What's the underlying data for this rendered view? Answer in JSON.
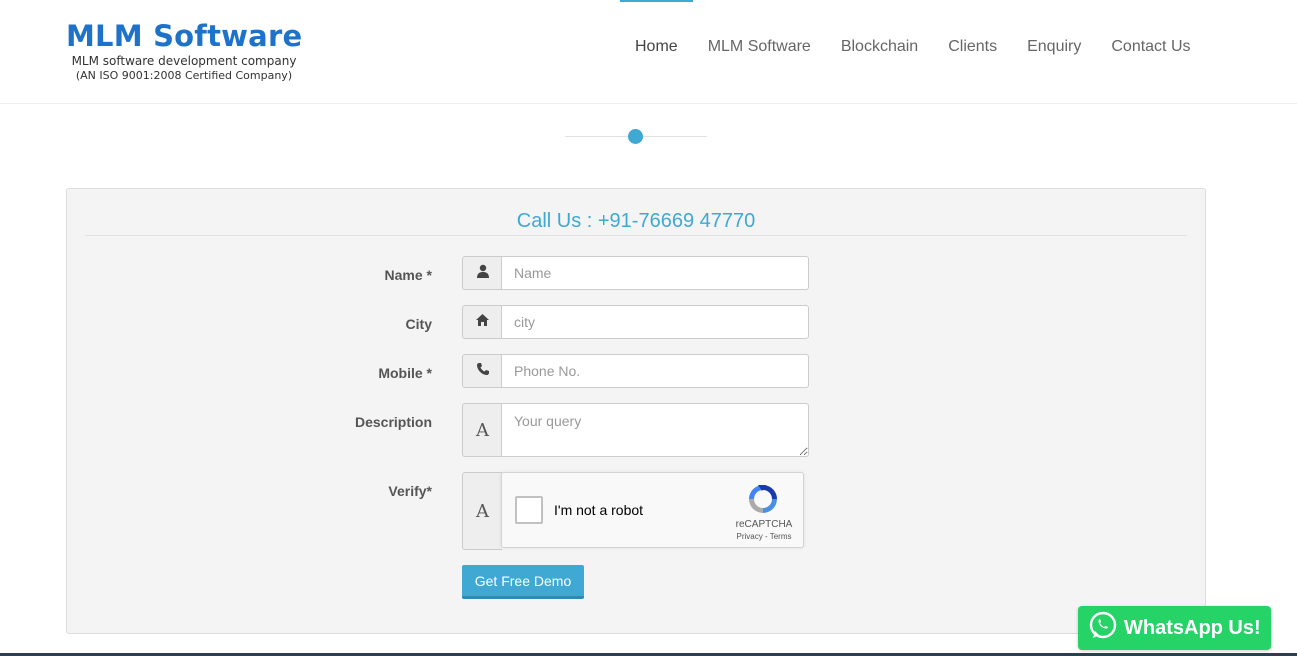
{
  "header": {
    "logo_title": "MLM Software",
    "logo_subtitle": "MLM software development company",
    "logo_certification": "(AN ISO 9001:2008 Certified Company)",
    "nav": [
      {
        "label": "Home",
        "active": true
      },
      {
        "label": "MLM Software"
      },
      {
        "label": "Blockchain"
      },
      {
        "label": "Clients"
      },
      {
        "label": "Enquiry"
      },
      {
        "label": "Contact Us"
      }
    ],
    "accent_color": "#3fa9d4"
  },
  "form": {
    "title": "Call Us : +91-76669 47770",
    "name": {
      "label": "Name *",
      "placeholder": "Name",
      "icon": "user-icon"
    },
    "city": {
      "label": "City",
      "placeholder": "city",
      "icon": "home-icon"
    },
    "mobile": {
      "label": "Mobile *",
      "placeholder": "Phone No.",
      "icon": "phone-icon"
    },
    "description": {
      "label": "Description",
      "placeholder": "Your query",
      "icon": "font-icon",
      "icon_glyph": "A"
    },
    "verify": {
      "label": "Verify*",
      "icon_glyph": "A"
    },
    "recaptcha": {
      "checkbox_label": "I'm not a robot",
      "brand": "reCAPTCHA",
      "links": "Privacy - Terms"
    },
    "submit_label": "Get Free Demo"
  },
  "whatsapp": {
    "label": "WhatsApp Us!",
    "color": "#25d366"
  }
}
